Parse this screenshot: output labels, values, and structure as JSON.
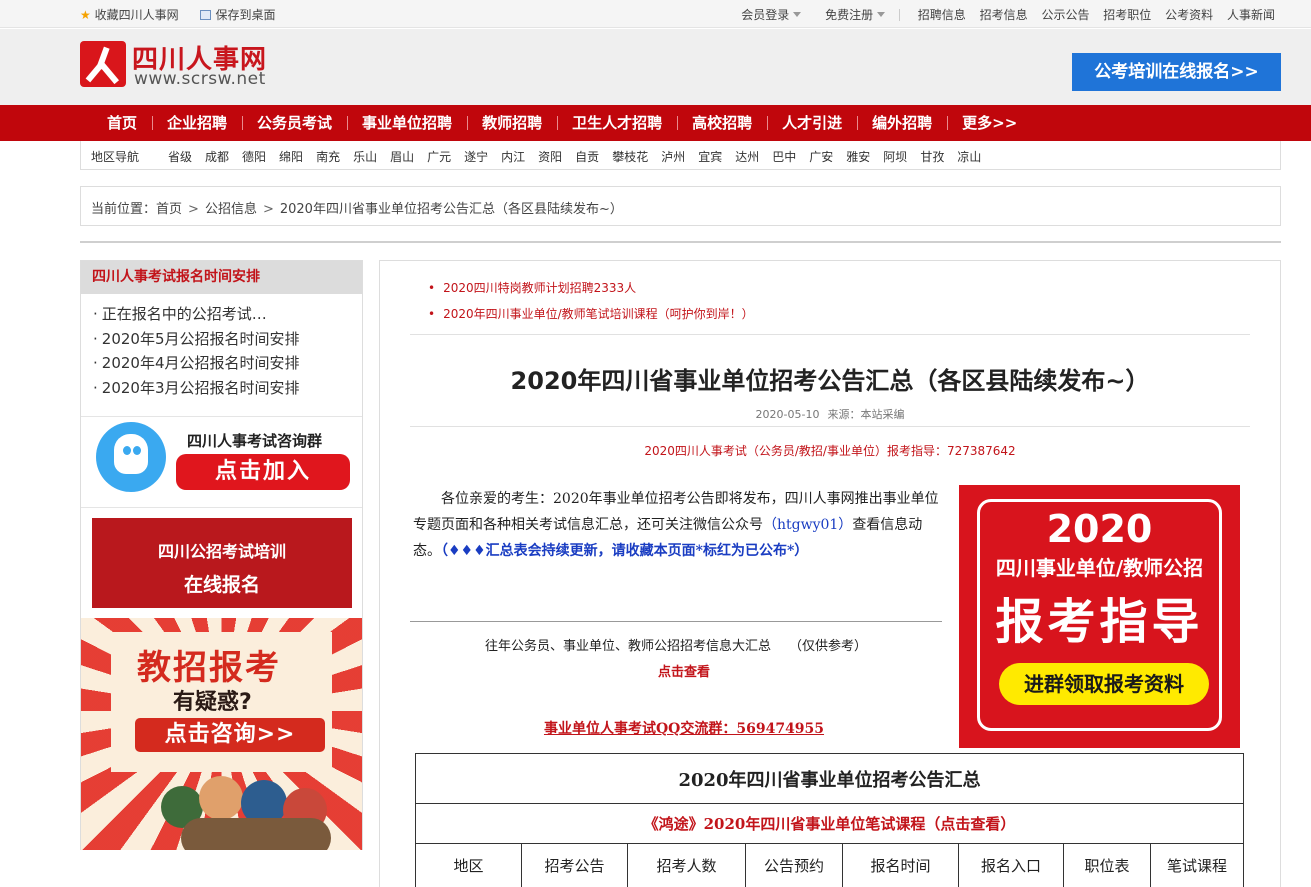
{
  "topbar": {
    "favorite": "收藏四川人事网",
    "save_desktop": "保存到桌面",
    "login": "会员登录",
    "register": "免费注册",
    "links": [
      "招聘信息",
      "招考信息",
      "公示公告",
      "招考职位",
      "公考资料",
      "人事新闻"
    ]
  },
  "header": {
    "logo_cn": "四川人事网",
    "logo_en": "www.scrsw.net",
    "cta": "公考培训在线报名>>"
  },
  "main_nav": [
    "首页",
    "企业招聘",
    "公务员考试",
    "事业单位招聘",
    "教师招聘",
    "卫生人才招聘",
    "高校招聘",
    "人才引进",
    "编外招聘",
    "更多>>"
  ],
  "region_nav": {
    "title": "地区导航",
    "items": [
      "省级",
      "成都",
      "德阳",
      "绵阳",
      "南充",
      "乐山",
      "眉山",
      "广元",
      "遂宁",
      "内江",
      "资阳",
      "自贡",
      "攀枝花",
      "泸州",
      "宜宾",
      "达州",
      "巴中",
      "广安",
      "雅安",
      "阿坝",
      "甘孜",
      "凉山"
    ]
  },
  "breadcrumb": {
    "prefix": "当前位置：",
    "home": "首页",
    "section": "公招信息",
    "current": "2020年四川省事业单位招考公告汇总（各区县陆续发布~）"
  },
  "sidebar": {
    "title": "四川人事考试报名时间安排",
    "items": [
      "正在报名中的公招考试…",
      "2020年5月公招报名时间安排",
      "2020年4月公招报名时间安排",
      "2020年3月公招报名时间安排"
    ],
    "qq_group_label": "四川人事考试咨询群",
    "qq_join": "点击加入",
    "train_line1": "四川公招考试培训",
    "train_line2": "在线报名",
    "ad_line1": "教招报考",
    "ad_line2": "有疑惑?",
    "ad_line3": "点击咨询>>"
  },
  "article": {
    "hot_links": [
      "2020四川特岗教师计划招聘2333人",
      "2020年四川事业单位/教师笔试培训课程（呵护你到岸！）"
    ],
    "title": "2020年四川省事业单位招考公告汇总（各区县陆续发布~）",
    "date": "2020-05-10",
    "source": "来源：本站采编",
    "guide": "2020四川人事考试（公务员/教招/事业单位）报考指导：727387642",
    "intro_a": "各位亲爱的考生：2020年事业单位招考公告即将发布，四川人事网推出事业单位专题页面和各种相关考试信息汇总，还可关注微信公众号",
    "intro_wechat": "（htgwy01）",
    "intro_b": "查看信息动态。",
    "intro_note": "（♦♦♦汇总表会持续更新，请收藏本页面*标红为已公布*）",
    "history": "往年公务员、事业单位、教师公招招考信息大汇总",
    "history_note": "（仅供参考）",
    "history_link": "点击查看",
    "qq_group": "事业单位人事考试QQ交流群：569474955",
    "promo_year": "2020",
    "promo_sub": "四川事业单位/教师公招",
    "promo_big": "报考指导",
    "promo_btn": "进群领取报考资料"
  },
  "table": {
    "title": "2020年四川省事业单位招考公告汇总",
    "course": "《鸿途》2020年四川省事业单位笔试课程（点击查看）",
    "headers": [
      "地区",
      "招考公告",
      "招考人数",
      "公告预约",
      "报名时间",
      "报名入口",
      "职位表",
      "笔试课程"
    ]
  },
  "colors": {
    "brand_red": "#c0060c",
    "link_red": "#c2141a",
    "cta_blue": "#1f74d8",
    "note_blue": "#1a3dc2"
  }
}
